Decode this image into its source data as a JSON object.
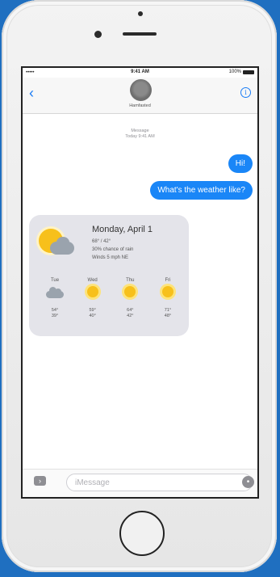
{
  "status_bar": {
    "signal": "•••••",
    "carrier_icon": "wifi-icon",
    "time": "9:41 AM",
    "battery_text": "100%"
  },
  "header": {
    "back_icon": "chevron-left-icon",
    "contact_name": "Hamfasted",
    "info_icon": "info-icon",
    "info_glyph": "i"
  },
  "thread_meta": {
    "service": "Message",
    "timestamp": "Today 9:41 AM"
  },
  "messages": [
    {
      "from": "me",
      "text": "Hi!"
    },
    {
      "from": "me",
      "text": "What's the weather like?"
    }
  ],
  "weather": {
    "title": "Monday, April 1",
    "lines": [
      "68° / 42°",
      "30% chance of rain",
      "Winds 5 mph NE"
    ],
    "forecast": [
      {
        "day": "Tue",
        "icon": "cloud-icon",
        "high": "54°",
        "low": "39°"
      },
      {
        "day": "Wed",
        "icon": "sun-icon",
        "high": "59°",
        "low": "40°"
      },
      {
        "day": "Thu",
        "icon": "sun-icon",
        "high": "64°",
        "low": "42°"
      },
      {
        "day": "Fri",
        "icon": "sun-icon",
        "high": "71°",
        "low": "48°"
      }
    ]
  },
  "composer": {
    "camera_icon": "camera-icon",
    "placeholder": "iMessage",
    "mic_icon": "microphone-icon"
  },
  "colors": {
    "bubble_blue": "#1a86f7",
    "background": "#1f6fc0",
    "sun": "#f7c01b"
  }
}
